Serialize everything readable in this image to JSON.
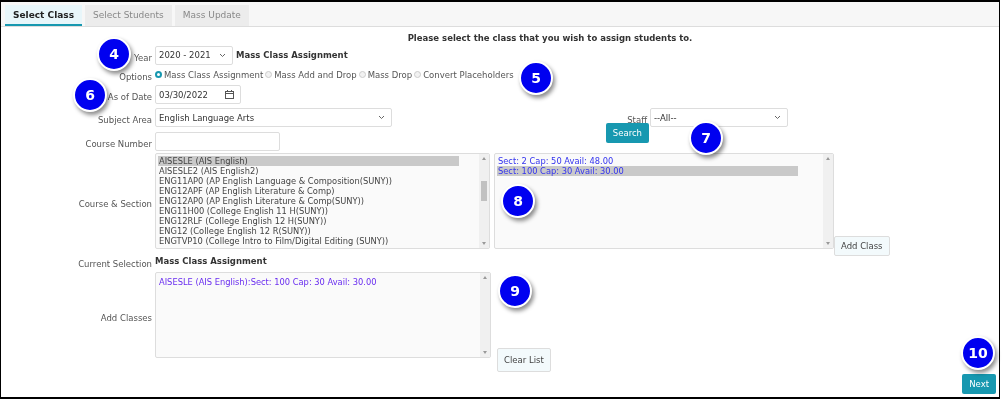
{
  "tabs": [
    {
      "label": "Select Class",
      "selected": true
    },
    {
      "label": "Select Students",
      "selected": false
    },
    {
      "label": "Mass Update",
      "selected": false
    }
  ],
  "instruction": "Please select the class that you wish to assign students to.",
  "year": {
    "label": "Year",
    "value": "2020 - 2021",
    "mode": "Mass Class Assignment",
    "callout": "4"
  },
  "options": {
    "label": "Options",
    "callout": "5",
    "items": [
      {
        "label": "Mass Class Assignment",
        "selected": true
      },
      {
        "label": "Mass Add and Drop",
        "selected": false
      },
      {
        "label": "Mass Drop",
        "selected": false
      },
      {
        "label": "Convert Placeholders",
        "selected": false
      }
    ]
  },
  "as_of_date": {
    "label": "As of Date",
    "value": "03/30/2022",
    "callout": "6"
  },
  "subject_area": {
    "label": "Subject Area",
    "value": "English Language Arts"
  },
  "staff": {
    "label": "Staff",
    "value": "--All--"
  },
  "course_number": {
    "label": "Course Number"
  },
  "search_button": {
    "label": "Search",
    "callout": "7"
  },
  "course_section": {
    "label": "Course & Section",
    "callout": "8",
    "courses": [
      {
        "label": "AISESLE (AIS English)",
        "selected": true
      },
      {
        "label": "AISESLE2 (AIS English2)",
        "selected": false
      },
      {
        "label": "ENG11AP0 (AP English Language & Composition(SUNY))",
        "selected": false
      },
      {
        "label": "ENG12APF (AP English Literature & Comp)",
        "selected": false
      },
      {
        "label": "ENG12AP0 (AP English Literature & Comp(SUNY))",
        "selected": false
      },
      {
        "label": "ENG11H00 (College English 11 H(SUNY))",
        "selected": false
      },
      {
        "label": "ENG12RLF (College English 12 H(SUNY))",
        "selected": false
      },
      {
        "label": "ENG12 (College English 12 R(SUNY))",
        "selected": false
      },
      {
        "label": "ENGTVP10 (College Intro to Film/Digital Editing (SUNY))",
        "selected": false
      }
    ],
    "sections": [
      {
        "label": "Sect: 2 Cap: 50 Avail: 48.00",
        "selected": false
      },
      {
        "label": "Sect: 100 Cap: 30 Avail: 30.00",
        "selected": true
      }
    ]
  },
  "add_class_button": "Add Class",
  "current_selection": {
    "label": "Current Selection",
    "value": "Mass Class Assignment"
  },
  "add_classes": {
    "label": "Add Classes",
    "callout": "9",
    "items": [
      "AISESLE (AIS English):Sect: 100 Cap: 30 Avail: 30.00"
    ]
  },
  "clear_list_button": "Clear List",
  "next_button": {
    "label": "Next",
    "callout": "10"
  }
}
